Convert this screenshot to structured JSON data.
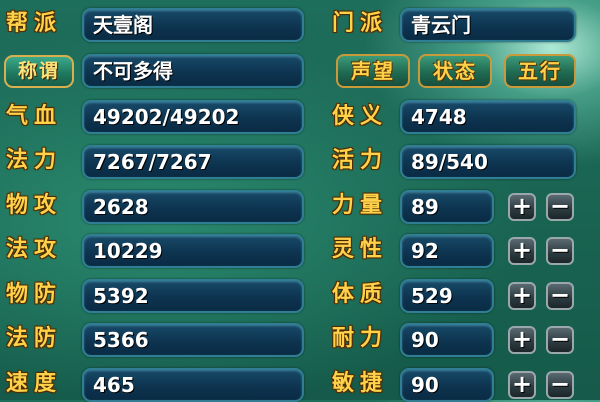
{
  "left_rows": [
    {
      "label": "帮派",
      "value": "天壹阁"
    },
    {
      "label": "称谓",
      "value": "不可多得"
    },
    {
      "label": "气血",
      "value": "49202/49202"
    },
    {
      "label": "法力",
      "value": "7267/7267"
    },
    {
      "label": "物攻",
      "value": "2628"
    },
    {
      "label": "法攻",
      "value": "10229"
    },
    {
      "label": "物防",
      "value": "5392"
    },
    {
      "label": "法防",
      "value": "5366"
    },
    {
      "label": "速度",
      "value": "465"
    }
  ],
  "right_rows": [
    {
      "label": "门派",
      "value": "青云门"
    },
    {
      "label": "侠义",
      "value": "4748"
    },
    {
      "label": "活力",
      "value": "89/540"
    },
    {
      "label": "力量",
      "value": "89"
    },
    {
      "label": "灵性",
      "value": "92"
    },
    {
      "label": "体质",
      "value": "529"
    },
    {
      "label": "耐力",
      "value": "90"
    },
    {
      "label": "敏捷",
      "value": "90"
    }
  ],
  "buttons": {
    "reputation": "声望",
    "status": "状态",
    "five_elements": "五行"
  },
  "controls": {
    "plus": "+",
    "minus": "−"
  },
  "colors": {
    "label_gold": "#ffd24a",
    "field_bg": "#0d3450",
    "field_border": "#2f7e94",
    "panel_bg": "#1a6553"
  }
}
